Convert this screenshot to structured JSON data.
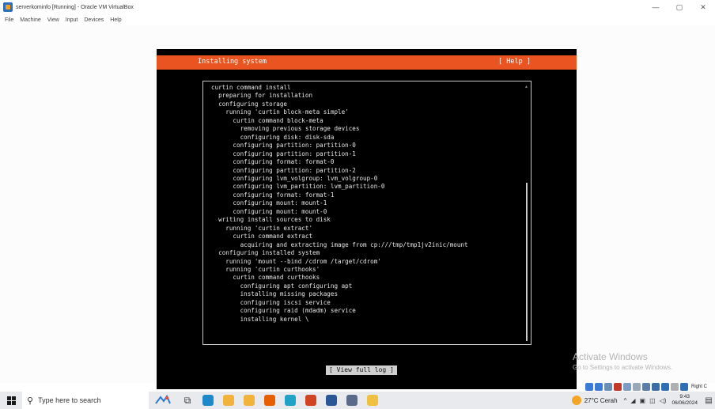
{
  "window": {
    "title": "serverkominfo [Running] - Oracle VM VirtualBox",
    "controls": {
      "minimize": "—",
      "maximize": "▢",
      "close": "✕"
    }
  },
  "menu": {
    "items": [
      "File",
      "Machine",
      "View",
      "Input",
      "Devices",
      "Help"
    ]
  },
  "installer": {
    "title": "Installing system",
    "help_label": "[ Help ]",
    "log_lines": [
      "curtin command install",
      "  preparing for installation",
      "  configuring storage",
      "    running 'curtin block-meta simple'",
      "      curtin command block-meta",
      "        removing previous storage devices",
      "        configuring disk: disk-sda",
      "      configuring partition: partition-0",
      "      configuring partition: partition-1",
      "      configuring format: format-0",
      "      configuring partition: partition-2",
      "      configuring lvm_volgroup: lvm_volgroup-0",
      "      configuring lvm_partition: lvm_partition-0",
      "      configuring format: format-1",
      "      configuring mount: mount-1",
      "      configuring mount: mount-0",
      "  writing install sources to disk",
      "    running 'curtin extract'",
      "      curtin command extract",
      "        acquiring and extracting image from cp:///tmp/tmp1jv2inic/mount",
      "  configuring installed system",
      "    running 'mount --bind /cdrom /target/cdrom'",
      "    running 'curtin curthooks'",
      "      curtin command curthooks",
      "        configuring apt configuring apt",
      "        installing missing packages",
      "        configuring iscsi service",
      "        configuring raid (mdadm) service",
      "        installing kernel \\"
    ],
    "view_full_log_label": "[ View full log ]"
  },
  "watermark": {
    "title": "Activate Windows",
    "subtitle": "Go to Settings to activate Windows."
  },
  "vbox_status": {
    "host_key": "Right C",
    "icon_colors": [
      "#3a7bd5",
      "#3a7bd5",
      "#6a8fb5",
      "#c0392b",
      "#7a9cc4",
      "#9aa9b8",
      "#5b7fa6",
      "#3a6ea5",
      "#2f6db5",
      "#b0b0b0",
      "#2f6db5"
    ]
  },
  "taskbar": {
    "search_placeholder": "Type here to search",
    "apps": [
      {
        "name": "task-view",
        "glyph": "⧉",
        "color": "#333333"
      },
      {
        "name": "ubuntu-vm",
        "glyph": "",
        "color": "#1e88c8"
      },
      {
        "name": "file-explorer",
        "glyph": "",
        "color": "#f2b33d"
      },
      {
        "name": "store",
        "glyph": "",
        "color": "#f2b33d"
      },
      {
        "name": "firefox",
        "glyph": "",
        "color": "#e66000"
      },
      {
        "name": "edge",
        "glyph": "",
        "color": "#1fa3c6"
      },
      {
        "name": "powerpoint",
        "glyph": "",
        "color": "#d04423"
      },
      {
        "name": "word",
        "glyph": "",
        "color": "#2b5797"
      },
      {
        "name": "virtualbox",
        "glyph": "",
        "color": "#5a6b8a"
      },
      {
        "name": "paint",
        "glyph": "",
        "color": "#f0c040"
      }
    ],
    "weather": "27°C Cerah",
    "tray_glyphs": [
      "^",
      "◢",
      "▣",
      "◫",
      "◁)"
    ],
    "time": "9:43",
    "date": "06/06/2024",
    "notification_glyph": "▤"
  }
}
